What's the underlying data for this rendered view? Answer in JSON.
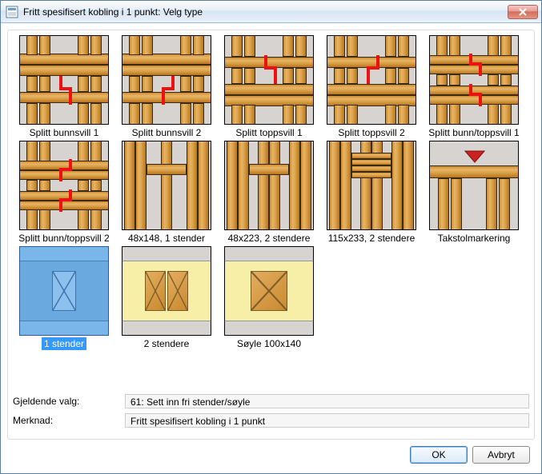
{
  "window": {
    "title": "Fritt spesifisert kobling i 1 punkt: Velg type"
  },
  "tiles": [
    {
      "label": "Splitt bunnsvill 1"
    },
    {
      "label": "Splitt bunnsvill 2"
    },
    {
      "label": "Splitt toppsvill 1"
    },
    {
      "label": "Splitt toppsvill 2"
    },
    {
      "label": "Splitt bunn/toppsvill 1"
    },
    {
      "label": "Splitt bunn/toppsvill 2"
    },
    {
      "label": "48x148, 1 stender"
    },
    {
      "label": "48x223, 2 stendere"
    },
    {
      "label": "115x233, 2 stendere"
    },
    {
      "label": "Takstolmarkering"
    },
    {
      "label": "1 stender"
    },
    {
      "label": "2 stendere"
    },
    {
      "label": "Søyle 100x140"
    }
  ],
  "selected_index": 10,
  "fields": {
    "gjeldende_label": "Gjeldende valg:",
    "gjeldende_value": "61: Sett inn fri stender/søyle",
    "merknad_label": "Merknad:",
    "merknad_value": "Fritt spesifisert kobling i 1 punkt"
  },
  "buttons": {
    "ok": "OK",
    "cancel": "Avbryt"
  }
}
